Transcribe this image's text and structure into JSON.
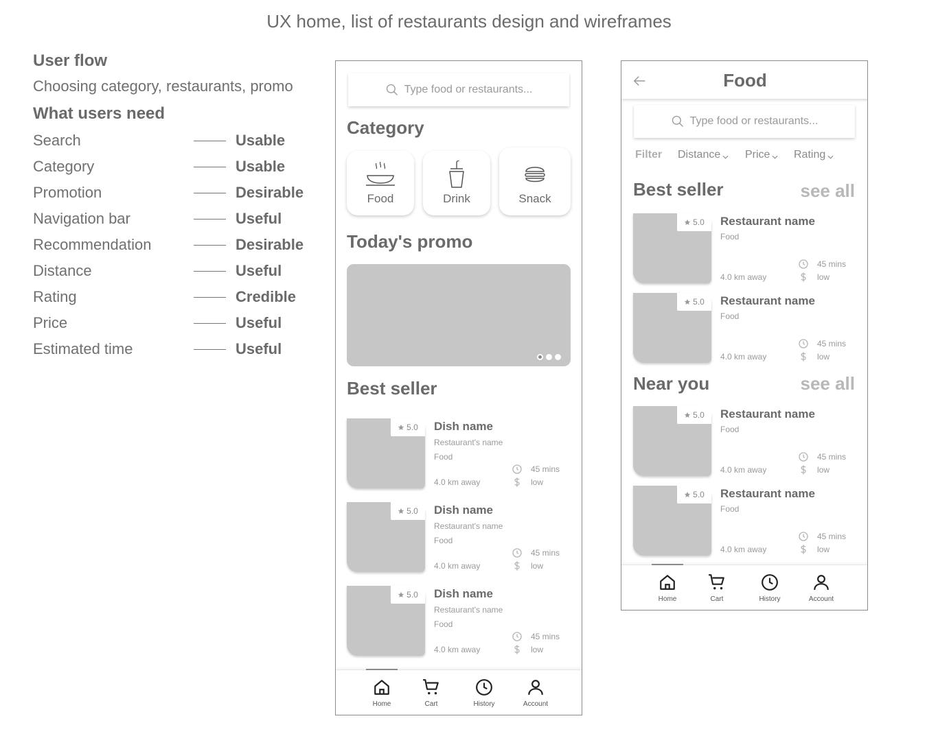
{
  "page_title": "UX home, list of restaurants design and wireframes",
  "flow": {
    "user_flow_title": "User flow",
    "user_flow_desc": "Choosing category, restaurants, promo",
    "needs_title": "What users need",
    "needs": [
      {
        "label": "Search",
        "value": "Usable"
      },
      {
        "label": "Category",
        "value": "Usable"
      },
      {
        "label": "Promotion",
        "value": "Desirable"
      },
      {
        "label": "Navigation bar",
        "value": "Useful"
      },
      {
        "label": "Recommendation",
        "value": "Desirable"
      },
      {
        "label": "Distance",
        "value": "Useful"
      },
      {
        "label": "Rating",
        "value": "Credible"
      },
      {
        "label": "Price",
        "value": "Useful"
      },
      {
        "label": "Estimated time",
        "value": "Useful"
      }
    ]
  },
  "home": {
    "search_placeholder": "Type food or restaurants...",
    "category_title": "Category",
    "categories": [
      {
        "label": "Food",
        "icon": "food-bowl-icon"
      },
      {
        "label": "Drink",
        "icon": "drink-cup-icon"
      },
      {
        "label": "Snack",
        "icon": "burger-icon"
      }
    ],
    "promo_title": "Today's promo",
    "best_seller_title": "Best seller",
    "items": [
      {
        "rating": "5.0",
        "name": "Dish name",
        "restaurant": "Restaurant's name",
        "category": "Food",
        "distance": "4.0 km away",
        "time": "45 mins",
        "price": "low"
      },
      {
        "rating": "5.0",
        "name": "Dish name",
        "restaurant": "Restaurant's name",
        "category": "Food",
        "distance": "4.0 km away",
        "time": "45 mins",
        "price": "low"
      },
      {
        "rating": "5.0",
        "name": "Dish name",
        "restaurant": "Restaurant's name",
        "category": "Food",
        "distance": "4.0 km away",
        "time": "45 mins",
        "price": "low"
      }
    ]
  },
  "food": {
    "title": "Food",
    "search_placeholder": "Type food or restaurants...",
    "filters": {
      "filter": "Filter",
      "distance": "Distance",
      "price": "Price",
      "rating": "Rating"
    },
    "best_seller_title": "Best seller",
    "near_you_title": "Near you",
    "see_all": "see all",
    "best_items": [
      {
        "rating": "5.0",
        "name": "Restaurant name",
        "category": "Food",
        "distance": "4.0 km away",
        "time": "45 mins",
        "price": "low"
      },
      {
        "rating": "5.0",
        "name": "Restaurant name",
        "category": "Food",
        "distance": "4.0 km away",
        "time": "45 mins",
        "price": "low"
      }
    ],
    "near_items": [
      {
        "rating": "5.0",
        "name": "Restaurant name",
        "category": "Food",
        "distance": "4.0 km away",
        "time": "45 mins",
        "price": "low"
      },
      {
        "rating": "5.0",
        "name": "Restaurant name",
        "category": "Food",
        "distance": "4.0 km away",
        "time": "45 mins",
        "price": "low"
      }
    ]
  },
  "nav": {
    "items": [
      {
        "label": "Home",
        "icon": "home-icon"
      },
      {
        "label": "Cart",
        "icon": "cart-icon"
      },
      {
        "label": "History",
        "icon": "clock-icon"
      },
      {
        "label": "Account",
        "icon": "user-icon"
      }
    ]
  }
}
